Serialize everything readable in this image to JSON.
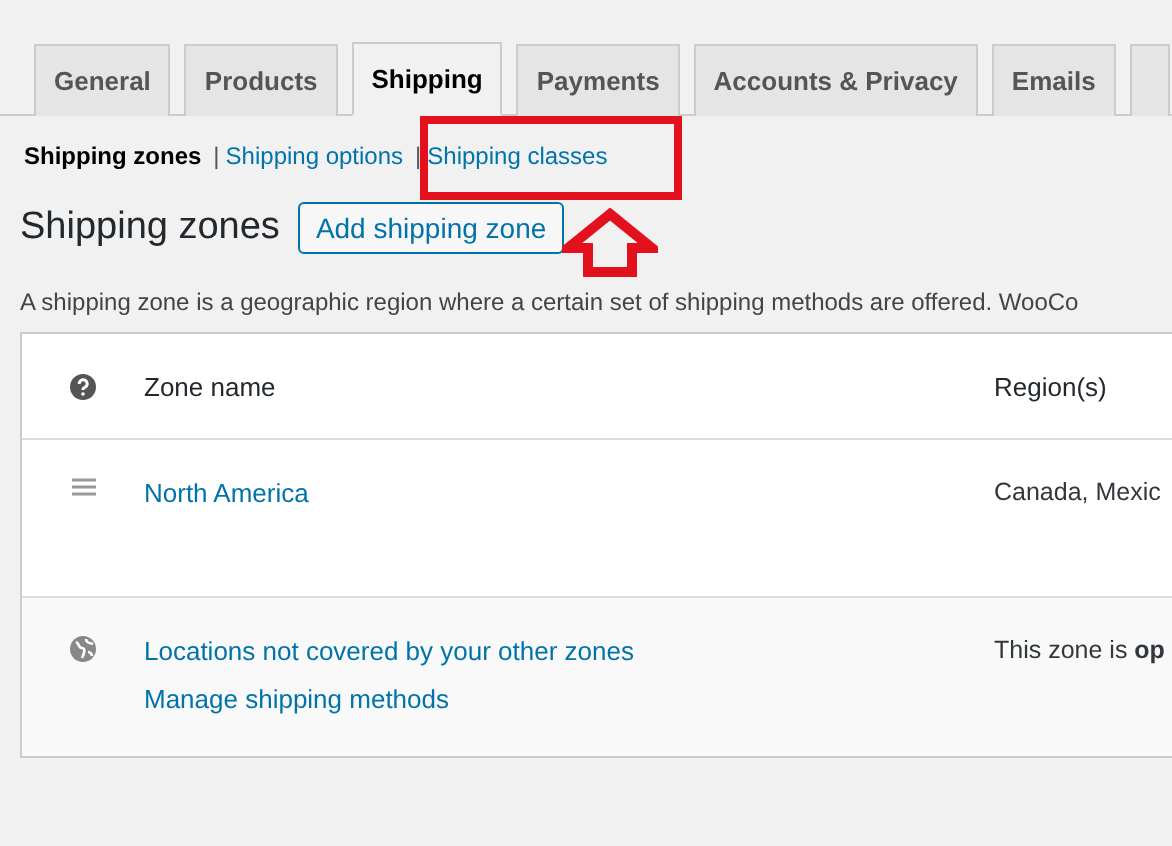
{
  "tabs": [
    {
      "label": "General",
      "selected": false
    },
    {
      "label": "Products",
      "selected": false
    },
    {
      "label": "Shipping",
      "selected": true
    },
    {
      "label": "Payments",
      "selected": false
    },
    {
      "label": "Accounts & Privacy",
      "selected": false
    },
    {
      "label": "Emails",
      "selected": false
    }
  ],
  "subnav": [
    {
      "label": "Shipping zones",
      "selected": true
    },
    {
      "separator": "|",
      "label": "Shipping options",
      "selected": false
    },
    {
      "separator": "|",
      "label": "Shipping classes",
      "selected": false
    }
  ],
  "heading": "Shipping zones",
  "add_button": "Add shipping zone",
  "description": "A shipping zone is a geographic region where a certain set of shipping methods are offered. WooCo",
  "table": {
    "columns": [
      "Zone name",
      "Region(s)"
    ],
    "rows": [
      {
        "kind": "zone",
        "name": "North America",
        "region": "Canada, Mexic"
      },
      {
        "kind": "fallback",
        "name": "Locations not covered by your other zones",
        "link": "Manage shipping methods",
        "region": "This zone is **op**"
      }
    ]
  }
}
